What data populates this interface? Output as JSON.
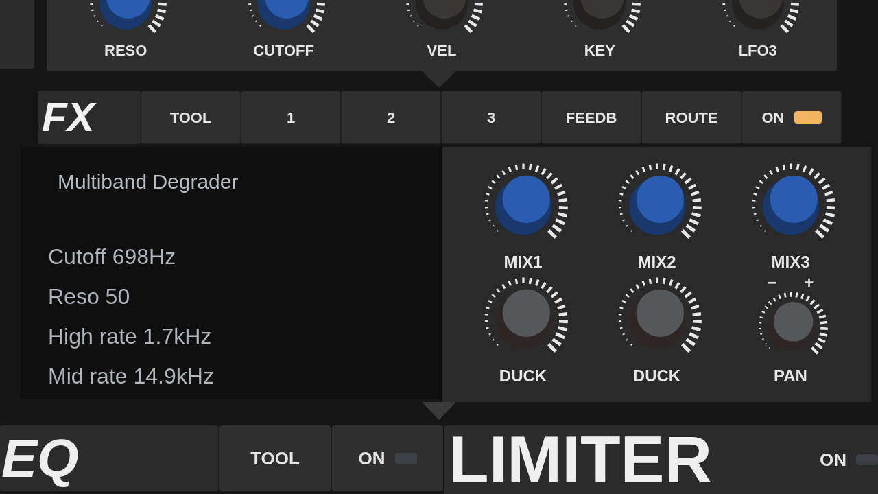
{
  "top_knobs": [
    {
      "label": "RESO",
      "kind": "blue"
    },
    {
      "label": "CUTOFF",
      "kind": "blue"
    },
    {
      "label": "VEL",
      "kind": "dark"
    },
    {
      "label": "KEY",
      "kind": "dark"
    },
    {
      "label": "LFO3",
      "kind": "dark"
    }
  ],
  "fx": {
    "title": "FX",
    "buttons": [
      {
        "label": "TOOL"
      },
      {
        "label": "1"
      },
      {
        "label": "2"
      },
      {
        "label": "3"
      },
      {
        "label": "FEEDB"
      },
      {
        "label": "ROUTE"
      }
    ],
    "power": {
      "label": "ON",
      "on": true
    },
    "display": {
      "title": "Multiband Degrader",
      "lines": [
        "Cutoff 698Hz",
        "Reso 50",
        "High rate 1.7kHz",
        "Mid rate 14.9kHz"
      ]
    },
    "knobs": [
      {
        "label": "MIX1",
        "kind": "blue"
      },
      {
        "label": "MIX2",
        "kind": "blue"
      },
      {
        "label": "MIX3",
        "kind": "blue"
      },
      {
        "label": "DUCK",
        "kind": "grey"
      },
      {
        "label": "DUCK",
        "kind": "grey"
      },
      {
        "label": "PAN",
        "kind": "grey",
        "scale_marks": [
          "−",
          "+"
        ]
      }
    ]
  },
  "eq": {
    "title": "EQ",
    "tool": "TOOL",
    "power": {
      "label": "ON",
      "on": false
    }
  },
  "limiter": {
    "title": "LIMITER",
    "power": {
      "label": "ON",
      "on": false
    }
  }
}
